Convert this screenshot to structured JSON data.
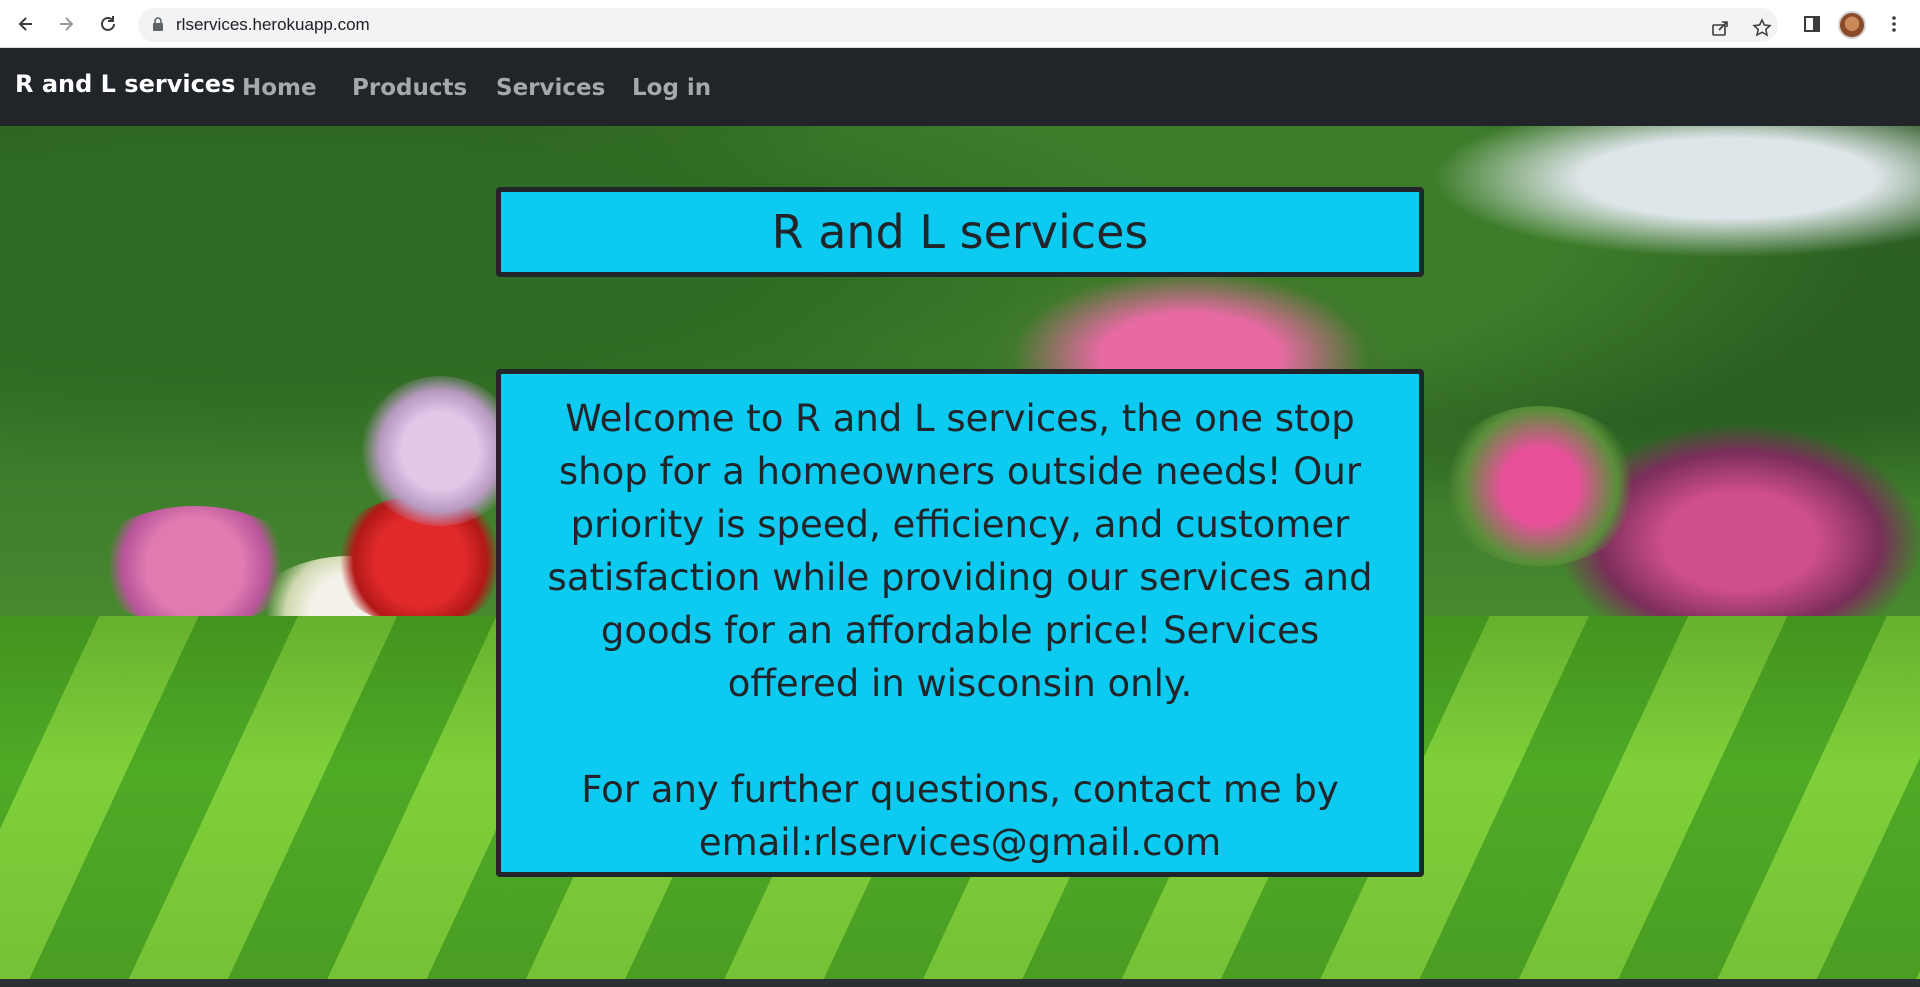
{
  "browser": {
    "url": "rlservices.herokuapp.com",
    "back_icon": "arrow-left-icon",
    "forward_icon": "arrow-right-icon",
    "reload_icon": "reload-icon",
    "lock_icon": "lock-icon",
    "share_icon": "share-icon",
    "bookmark_icon": "star-icon",
    "sidepanel_icon": "side-panel-icon",
    "menu_icon": "kebab-menu-icon"
  },
  "navbar": {
    "brand": "R and L services",
    "links": [
      "Home",
      "Products",
      "Services",
      "Log in"
    ]
  },
  "hero": {
    "title": "R and L services",
    "paragraph1": "Welcome to R and L services, the one stop shop for a homeowners outside needs! Our priority is speed, efficiency, and customer satisfaction while providing our services and goods for an affordable price! Services offered in wisconsin only.",
    "paragraph2": "For any further questions, contact me by email:rlservices@gmail.com"
  },
  "colors": {
    "navbar_bg": "#212529",
    "box_bg": "#0dcaf0",
    "box_border": "#212529"
  }
}
